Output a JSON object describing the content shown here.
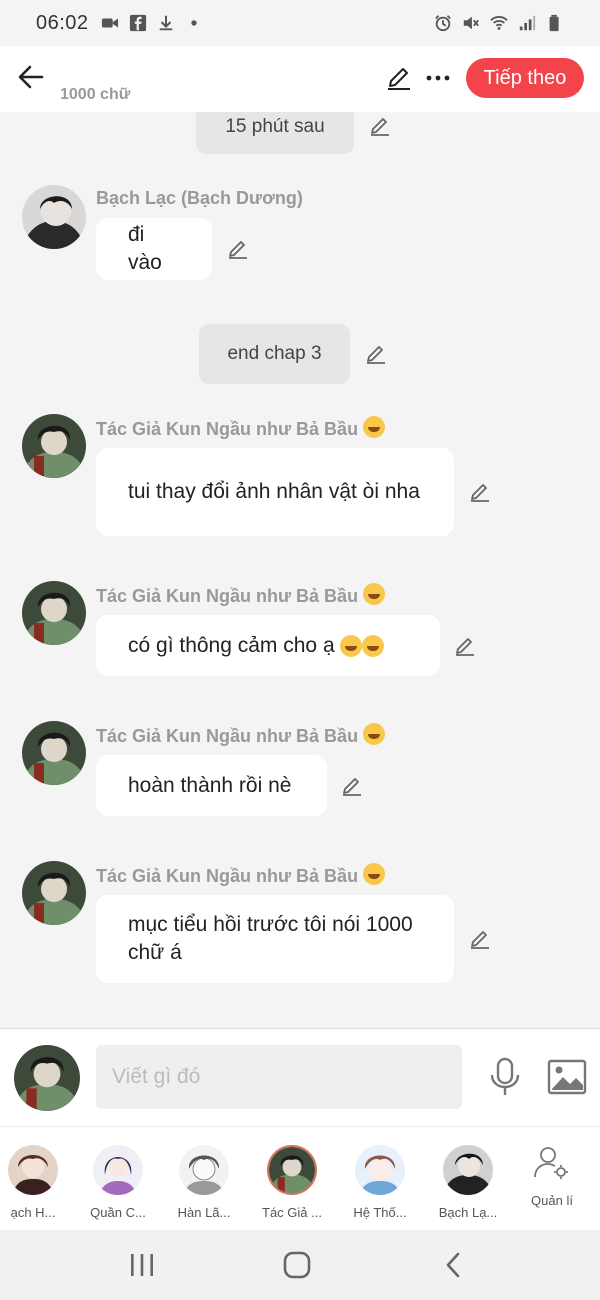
{
  "status_bar": {
    "time": "06:02"
  },
  "header": {
    "word_count": "1000 chữ",
    "next_label": "Tiếp theo"
  },
  "chat": {
    "system_1": "15 phút sau",
    "msg_1": {
      "name": "Bạch Lạc (Bạch Dương)",
      "text": "đi vào"
    },
    "system_2": "end chap 3",
    "author_name": "Tác Giả Kun Ngầu như Bả Bầu",
    "msg_2": {
      "text": "tui thay đổi ảnh nhân vật òi nha"
    },
    "msg_3": {
      "text": "có gì thông cảm cho ạ"
    },
    "msg_4": {
      "text": "hoàn thành rồi nè"
    },
    "msg_5": {
      "text": "mục tiểu hồi trước tôi nói 1000 chữ á"
    }
  },
  "composer": {
    "placeholder": "Viết gì đó"
  },
  "characters": [
    {
      "label": "ạch H..."
    },
    {
      "label": "Quần C..."
    },
    {
      "label": "Hàn Lã..."
    },
    {
      "label": "Tác Giả ..."
    },
    {
      "label": "Hệ Thố..."
    },
    {
      "label": "Bạch Lạ..."
    },
    {
      "label": "Quản lí"
    }
  ],
  "colors": {
    "accent": "#f2444a",
    "background": "#f4f4f4",
    "bubble": "#ffffff"
  }
}
